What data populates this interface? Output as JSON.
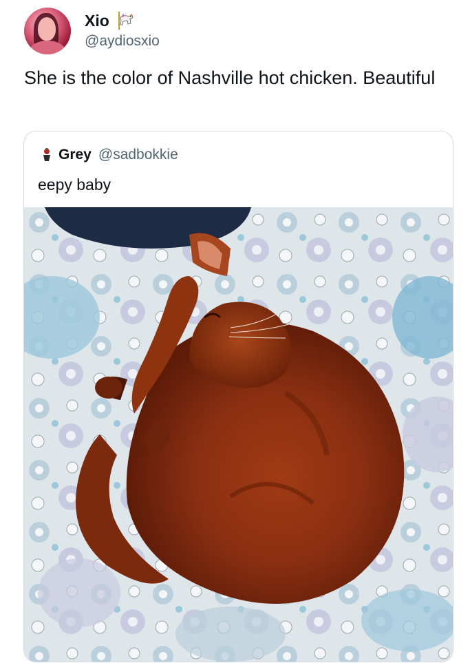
{
  "tweet": {
    "display_name": "Xio",
    "name_emoji_icon": "carousel-horse-icon",
    "handle": "@aydiosxio",
    "text": "She is the color of Nashville hot chicken. Beautiful"
  },
  "quoted_tweet": {
    "avatar_icon": "grey-avatar-icon",
    "display_name": "Grey",
    "handle": "@sadbokkie",
    "text": "eepy baby",
    "image": {
      "subject": "cat-photo",
      "colors": {
        "cat_fur": "#8a2f12",
        "blanket_blue": "#9cc8dc",
        "blanket_base": "#dfe6ea",
        "pillow_navy": "#1d2b45"
      }
    }
  }
}
